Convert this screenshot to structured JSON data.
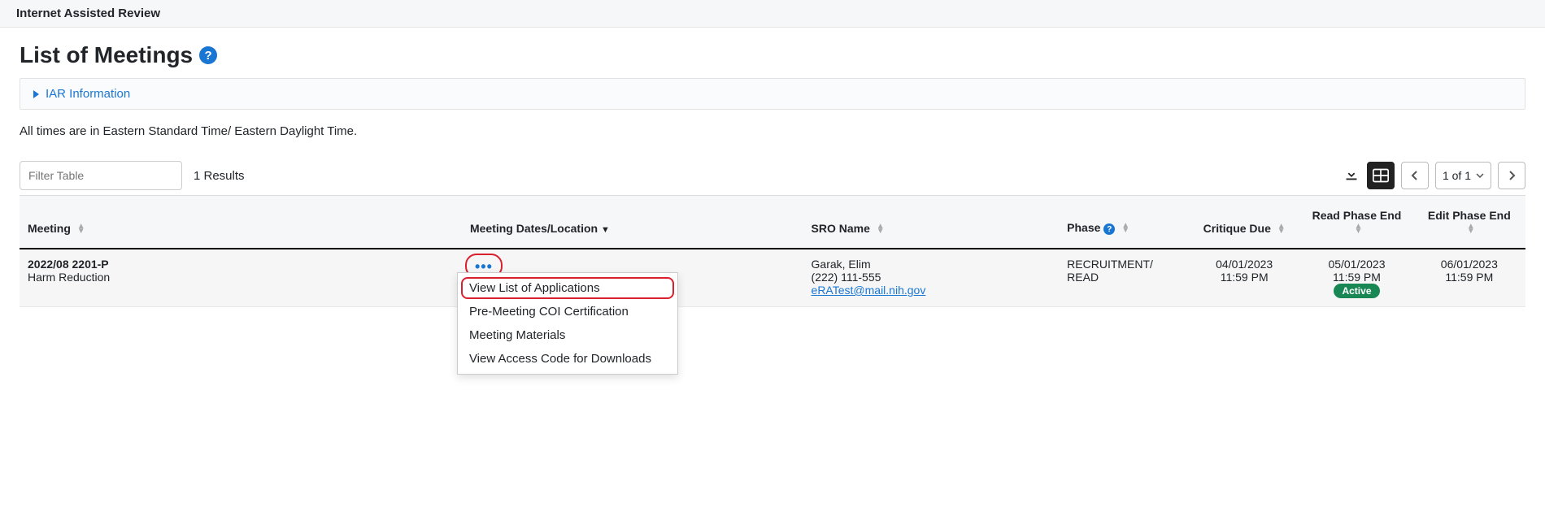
{
  "topbar": {
    "title": "Internet Assisted Review"
  },
  "page": {
    "title": "List of Meetings"
  },
  "infoPanel": {
    "label": "IAR Information"
  },
  "note": "All times are in Eastern Standard Time/ Eastern Daylight Time.",
  "filter": {
    "placeholder": "Filter Table",
    "results": "1 Results"
  },
  "pager": {
    "label": "1 of 1"
  },
  "columns": {
    "meeting": "Meeting",
    "datesLocation": "Meeting Dates/Location",
    "sro": "SRO Name",
    "phase": "Phase",
    "critique": "Critique Due",
    "readEnd": "Read Phase End",
    "editEnd": "Edit Phase End"
  },
  "row": {
    "meetingCode": "2022/08 2201-P",
    "meetingTitle": "Harm Reduction",
    "sroName": "Garak, Elim",
    "sroPhone": "(222) 111-555",
    "sroEmail": "eRATest@mail.nih.gov",
    "phaseLine1": "RECRUITMENT/",
    "phaseLine2": "READ",
    "critiqueDate": "04/01/2023",
    "critiqueTime": "11:59 PM",
    "readDate": "05/01/2023",
    "readTime": "11:59 PM",
    "readBadge": "Active",
    "editDate": "06/01/2023",
    "editTime": "11:59 PM"
  },
  "menu": {
    "item1": "View List of Applications",
    "item2": "Pre-Meeting COI Certification",
    "item3": "Meeting Materials",
    "item4": "View Access Code for Downloads"
  }
}
